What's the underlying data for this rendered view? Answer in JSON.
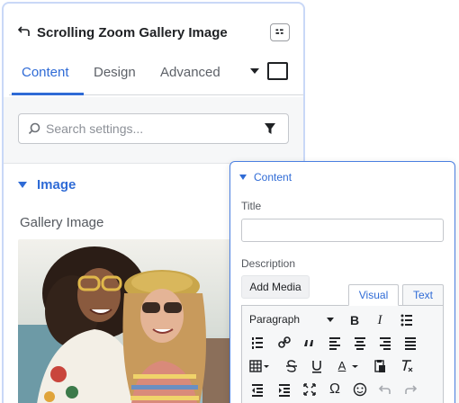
{
  "panel": {
    "title": "Scrolling Zoom Gallery Image",
    "tabs": [
      {
        "label": "Content",
        "active": true
      },
      {
        "label": "Design",
        "active": false
      },
      {
        "label": "Advanced",
        "active": false
      }
    ],
    "search": {
      "placeholder": "Search settings..."
    },
    "section": {
      "label": "Image"
    },
    "field_label": "Gallery Image"
  },
  "popover": {
    "section_label": "Content",
    "title_label": "Title",
    "title_value": "",
    "description_label": "Description",
    "add_media": "Add Media",
    "editor_tabs": {
      "visual": "Visual",
      "text": "Text"
    },
    "format_select": "Paragraph",
    "toolbar_glyphs": {
      "bold": "B",
      "italic": "I",
      "text_color": "A",
      "special_char": "Ω"
    }
  },
  "colors": {
    "accent": "#2f6bd6",
    "panel_border": "#c9d8f7",
    "popover_border": "#4a7fe0",
    "text_dark": "#1f2124",
    "text_muted": "#55595f"
  }
}
